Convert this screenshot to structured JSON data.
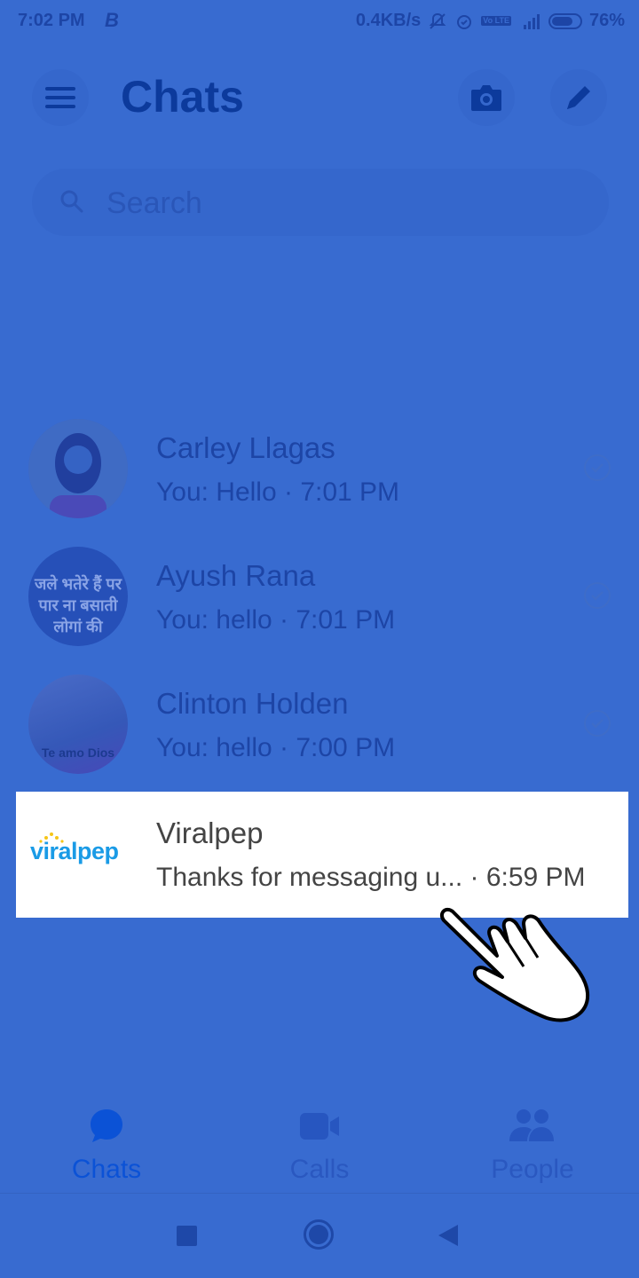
{
  "status_bar": {
    "time": "7:02 PM",
    "carrier_icon": "b-icon",
    "net_speed": "0.4KB/s",
    "network": "4G",
    "volte": "Vo LTE",
    "battery": "76%",
    "battery_level": 0.76
  },
  "header": {
    "title": "Chats",
    "menu_icon": "hamburger-icon",
    "camera_icon": "camera-icon",
    "compose_icon": "pencil-icon"
  },
  "search": {
    "placeholder": "Search"
  },
  "chats": [
    {
      "name": "Carley Llagas",
      "snippet": "You: Hello · 7:01 PM",
      "status": "sent-check"
    },
    {
      "name": "Ayush Rana",
      "snippet": "You: hello · 7:01 PM",
      "status": "sent-check",
      "avatar_text": "जले भतेरे हैं पर पार ना बसाती लोगां की"
    },
    {
      "name": "Clinton Holden",
      "snippet": "You: hello · 7:00 PM",
      "status": "sent-check",
      "avatar_text": "Te amo Dios"
    },
    {
      "name": "Viralpep",
      "snippet": "Thanks for messaging u... · 6:59 PM",
      "logo_text": "viralpep",
      "highlighted": true
    }
  ],
  "tabs": [
    {
      "label": "Chats",
      "icon": "chat-bubble-icon",
      "active": true
    },
    {
      "label": "Calls",
      "icon": "video-camera-icon",
      "active": false
    },
    {
      "label": "People",
      "icon": "people-icon",
      "active": false
    }
  ],
  "colors": {
    "overlay": "#386bd0",
    "active_tab": "#0b52d6",
    "viralpep_blue": "#1a9be6",
    "viralpep_yellow": "#f5c518"
  }
}
